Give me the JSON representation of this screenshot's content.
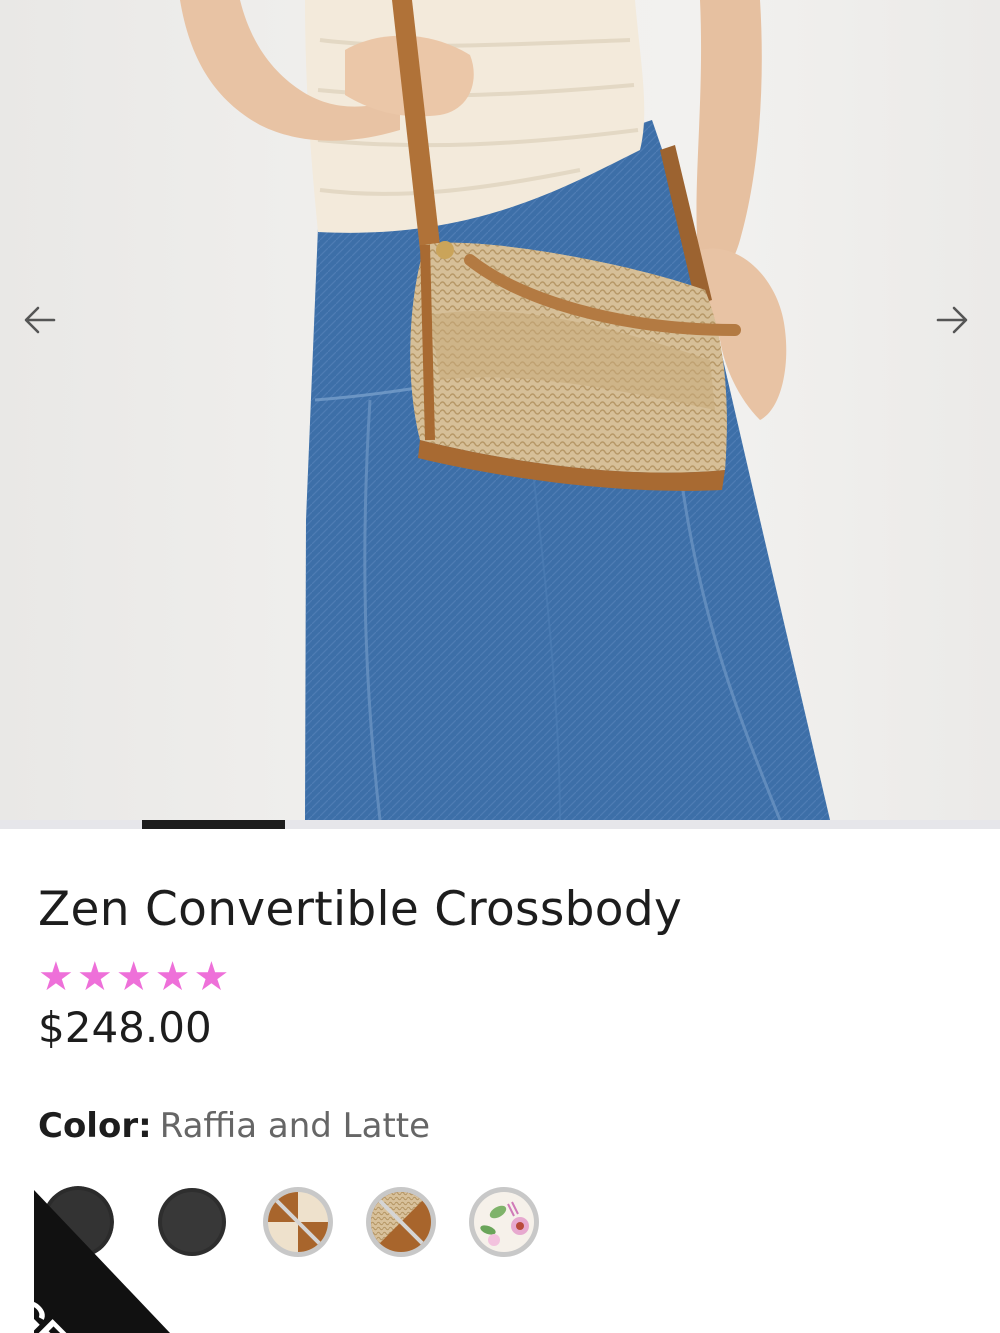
{
  "carousel": {
    "prev_icon": "arrow-left-icon",
    "next_icon": "arrow-right-icon",
    "progress": 0.143
  },
  "product": {
    "title": "Zen Convertible Crossbody",
    "rating": 5,
    "rating_max": 5,
    "star_color": "#ee70d9",
    "price": "$248.00",
    "color_label": "Color:",
    "color_value": "Raffia and Latte",
    "swatches": [
      {
        "name": "black-pebble"
      },
      {
        "name": "black"
      },
      {
        "name": "latte-and-cream"
      },
      {
        "name": "raffia-and-latte"
      },
      {
        "name": "floral-print"
      }
    ]
  },
  "badge": {
    "text": "GE"
  }
}
